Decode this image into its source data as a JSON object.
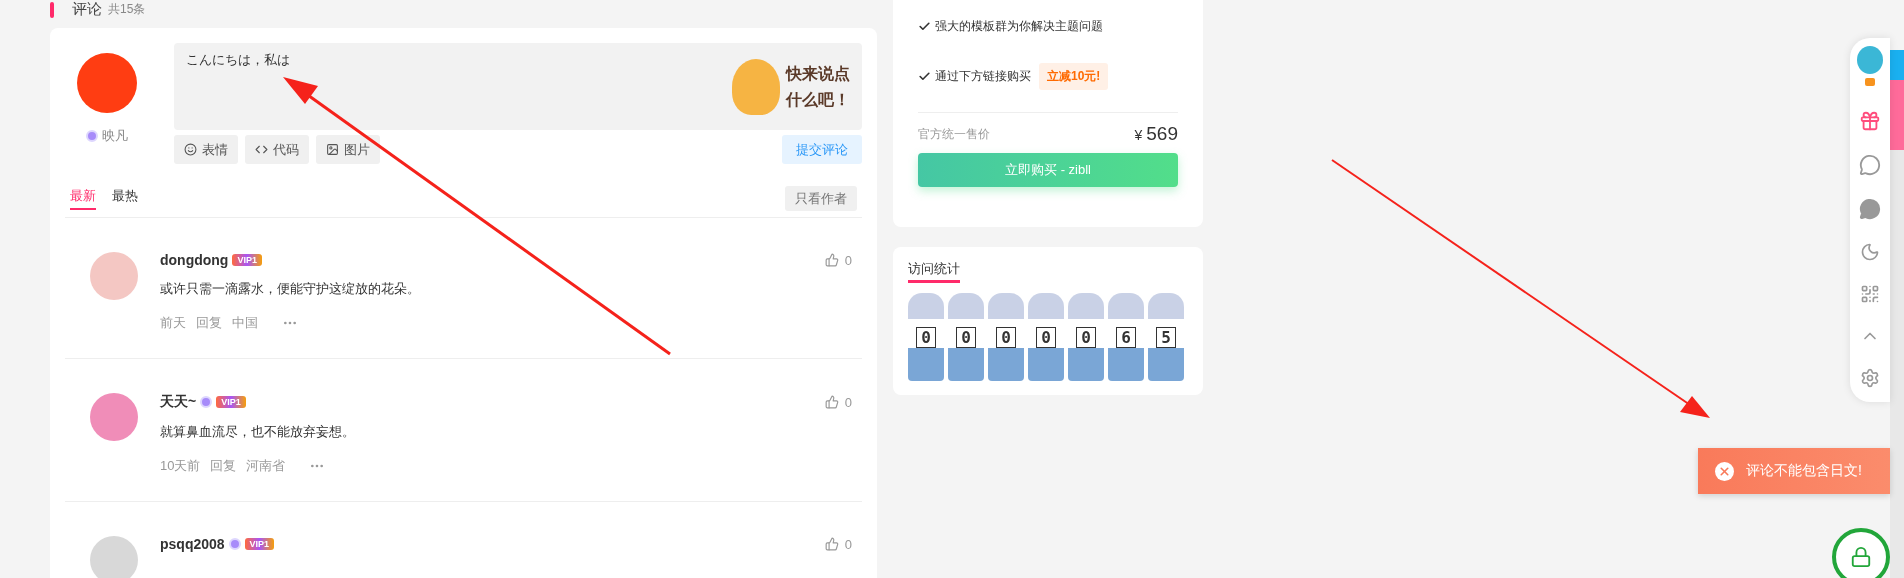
{
  "section": {
    "title": "评论",
    "count": "共15条"
  },
  "composer": {
    "user": "映凡",
    "value": "こんにちは，私は",
    "sticker_lines": [
      "快来说点",
      "什么吧！"
    ],
    "tools": [
      {
        "kind": "emoji",
        "label": "表情"
      },
      {
        "kind": "code",
        "label": "代码"
      },
      {
        "kind": "image",
        "label": "图片"
      }
    ],
    "submit": "提交评论"
  },
  "sort_tabs": [
    {
      "label": "最新",
      "selected": true
    },
    {
      "label": "最热",
      "selected": false
    }
  ],
  "author_filter": "只看作者",
  "comments": [
    {
      "user": "dongdong",
      "medal": false,
      "vip": "VIP1",
      "text": "或许只需一滴露水，便能守护这绽放的花朵。",
      "time": "前天",
      "reply": "回复",
      "location": "中国",
      "likes": "0"
    },
    {
      "user": "天天~",
      "medal": true,
      "vip": "VIP1",
      "text": "就算鼻血流尽，也不能放弃妄想。",
      "time": "10天前",
      "reply": "回复",
      "location": "河南省",
      "likes": "0"
    },
    {
      "user": "psqq2008",
      "medal": true,
      "vip": "VIP1",
      "likes": "0"
    }
  ],
  "product": {
    "features": [
      {
        "text": "强大的模板群为你解决主题问题"
      },
      {
        "text": "通过下方链接购买",
        "badge": "立减10元!"
      }
    ],
    "price_label": "官方统一售价",
    "currency": "¥",
    "price": "569",
    "buy": "立即购买 - zibll"
  },
  "visits": {
    "title": "访问统计",
    "digits": [
      "0",
      "0",
      "0",
      "0",
      "0",
      "6",
      "5"
    ]
  },
  "toast": {
    "text": "评论不能包含日文!"
  }
}
